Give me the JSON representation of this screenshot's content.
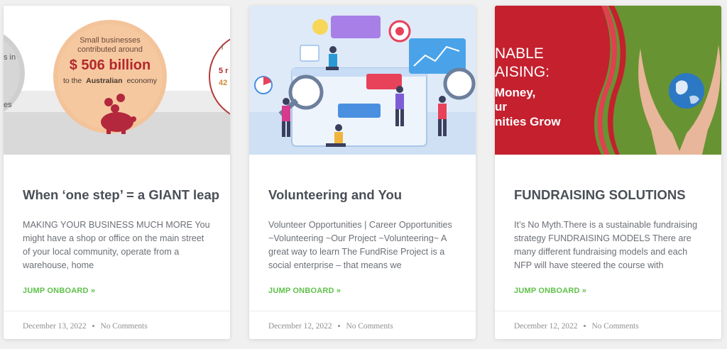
{
  "posts": [
    {
      "image_text": {
        "left_partial_line1": "s in",
        "left_partial_line2": "es",
        "line1": "Small businesses",
        "line2": "contributed around",
        "amount": "$ 506 billion",
        "line4_pre": "to the",
        "line4_bold": "Australian",
        "line4_post": "economy",
        "right_partial1": "i",
        "right_partial2": "5 r",
        "right_partial3": "42"
      },
      "title": "When ‘one step’ = a GIANT leap",
      "excerpt": "MAKING YOUR BUSINESS MUCH MORE You might have a shop or office on the main street of your local community, operate from a warehouse, home",
      "read_more": "JUMP ONBOARD »",
      "date": "December 13, 2022",
      "comments": "No Comments"
    },
    {
      "title": "Volunteering and You",
      "excerpt": "Volunteer Opportunities | Career Opportunities ~Volunteering ~Our Project ~Volunteering~ A great way to learn The FundRise Project is a social enterprise – that means we",
      "read_more": "JUMP ONBOARD »",
      "date": "December 12, 2022",
      "comments": "No Comments"
    },
    {
      "image_text": {
        "line1": "NABLE",
        "line2": "AISING:",
        "line3": "Money,",
        "line4": "ur",
        "line5": "nities Grow"
      },
      "title": "FUNDRAISING SOLUTIONS",
      "excerpt": "It’s No Myth.There is a sustainable fundraising strategy FUNDRAISING MODELS There are many different fundraising models and each NFP will have steered the course with",
      "read_more": "JUMP ONBOARD »",
      "date": "December 12, 2022",
      "comments": "No Comments"
    }
  ],
  "separator": "•",
  "colors": {
    "accent": "#5ec14a",
    "title": "#4a4f57",
    "card_bg": "#ffffff",
    "page_bg": "#f0f0f0"
  }
}
